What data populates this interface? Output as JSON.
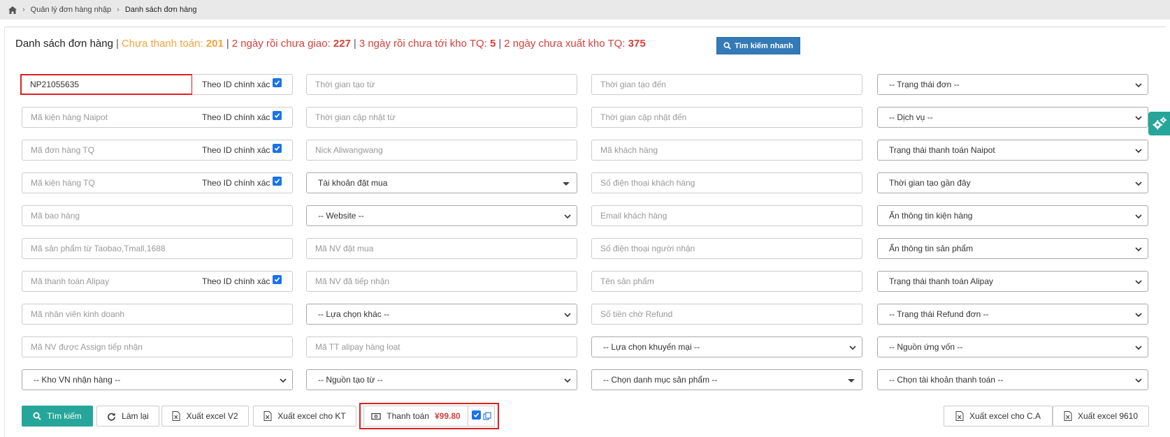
{
  "breadcrumb": {
    "items": [
      "Quản lý đơn hàng nhập",
      "Danh sách đơn hàng"
    ]
  },
  "heading": {
    "title": "Danh sách đơn hàng",
    "unpaid_label": "Chưa thanh toán:",
    "unpaid_count": "201",
    "undelivered_label": "2 ngày rồi chưa giao:",
    "undelivered_count": "227",
    "not_arrived_label": "3 ngày rồi chưa tới kho TQ:",
    "not_arrived_count": "5",
    "not_exported_label": "2 ngày chưa xuất kho TQ:",
    "not_exported_count": "375",
    "quick_search": "Tìm kiếm nhanh"
  },
  "exact_label": "Theo ID chính xác",
  "filters": {
    "order_id_value": "NP21055635",
    "package_naipot": "Mã kiện hàng Naipot",
    "order_tq": "Mã đơn hàng TQ",
    "package_tq": "Mã kiện hàng TQ",
    "bag_code": "Mã bao hàng",
    "product_code": "Mã sản phẩm từ Taobao,Tmall,1688",
    "alipay_code": "Mã thanh toán Alipay",
    "sales_staff": "Mã nhân viên kinh doanh",
    "assign_staff": "Mã NV được Assign tiếp nhận",
    "vn_warehouse": "-- Kho VN nhận hàng --",
    "created_from": "Thời gian tạo từ",
    "updated_from": "Thời gian cập nhật từ",
    "nick": "Nick Aliwangwang",
    "buy_account": "Tài khoản đặt mua",
    "website": "-- Website --",
    "buyer_staff": "Mã NV đặt mua",
    "receiver_staff": "Mã NV đã tiếp nhận",
    "other_choice": "-- Lựa chọn khác --",
    "alipay_batch": "Mã TT alipay hàng loạt",
    "source_from": "-- Nguồn tạo từ --",
    "created_to": "Thời gian tạo đến",
    "updated_to": "Thời gian cập nhật đến",
    "customer_code": "Mã khách hàng",
    "customer_phone": "Số điện thoại khách hàng",
    "customer_email": "Email khách hàng",
    "receiver_phone": "Số điện thoại người nhận",
    "product_name": "Tên sản phẩm",
    "refund_amount": "Số tiền chờ Refund",
    "promotion": "-- Lựa chọn khuyến mại --",
    "category": "-- Chọn danh mục sản phẩm --",
    "order_status": "-- Trạng thái đơn --",
    "service": "-- Dịch vụ --",
    "naipot_pay_status": "Trạng thái thanh toán Naipot",
    "recent_time": "Thời gian tạo gần đây",
    "hide_package": "Ẩn thông tin kiện hàng",
    "hide_product": "Ẩn thông tin sản phẩm",
    "alipay_status": "Trạng thái thanh toán Alipay",
    "refund_status": "-- Trạng thái Refund đơn --",
    "funding_source": "-- Nguồn ứng vốn --",
    "pay_account": "-- Chọn tài khoản thanh toán --"
  },
  "actions": {
    "search": "Tìm kiếm",
    "reset": "Làm lại",
    "excel_v2": "Xuất excel V2",
    "excel_kt": "Xuất excel cho KT",
    "pay_label": "Thanh toán",
    "pay_amount": "¥99.80",
    "excel_ca": "Xuất excel cho C.A",
    "excel_9610": "Xuất excel 9610"
  },
  "colors": {
    "accent": "#26a69a",
    "primary": "#337ab7",
    "highlight": "#e02020",
    "warning": "#f0a43a",
    "danger": "#d43f3a"
  }
}
